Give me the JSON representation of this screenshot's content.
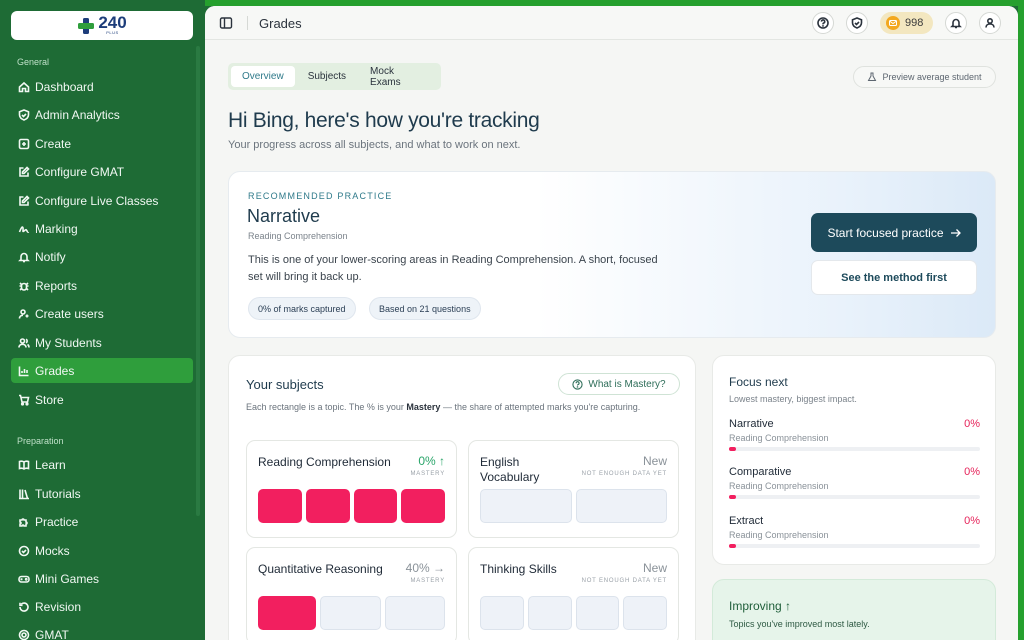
{
  "logo": {
    "number": "240",
    "sub": "PLUS"
  },
  "sidebar": {
    "sections": [
      {
        "label": "General"
      },
      {
        "label": "Preparation"
      }
    ],
    "general_items": [
      {
        "label": "Dashboard",
        "icon": "home-icon"
      },
      {
        "label": "Admin Analytics",
        "icon": "shield-icon"
      },
      {
        "label": "Create",
        "icon": "plus-square-icon"
      },
      {
        "label": "Configure GMAT",
        "icon": "edit-square-icon"
      },
      {
        "label": "Configure Live Classes",
        "icon": "edit-square-icon"
      },
      {
        "label": "Marking",
        "icon": "signature-icon"
      },
      {
        "label": "Notify",
        "icon": "bell-icon"
      },
      {
        "label": "Reports",
        "icon": "bug-icon"
      },
      {
        "label": "Create users",
        "icon": "user-plus-icon"
      },
      {
        "label": "My Students",
        "icon": "users-icon"
      },
      {
        "label": "Grades",
        "icon": "chart-icon",
        "active": true
      },
      {
        "label": "Store",
        "icon": "cart-icon"
      }
    ],
    "prep_items": [
      {
        "label": "Learn",
        "icon": "book-icon"
      },
      {
        "label": "Tutorials",
        "icon": "library-icon"
      },
      {
        "label": "Practice",
        "icon": "puzzle-icon"
      },
      {
        "label": "Mocks",
        "icon": "check-circle-icon"
      },
      {
        "label": "Mini Games",
        "icon": "gamepad-icon"
      },
      {
        "label": "Revision",
        "icon": "refresh-icon"
      },
      {
        "label": "GMAT",
        "icon": "target-icon"
      }
    ]
  },
  "topbar": {
    "title": "Grades",
    "coins": "998"
  },
  "tabs": [
    "Overview",
    "Subjects",
    "Mock Exams"
  ],
  "preview_label": "Preview average student",
  "greeting": "Hi Bing, here's how you're tracking",
  "greeting_sub": "Your progress across all subjects, and what to work on next.",
  "recommended": {
    "eyebrow": "RECOMMENDED PRACTICE",
    "title": "Narrative",
    "subject": "Reading Comprehension",
    "description": "This is one of your lower-scoring areas in Reading Comprehension. A short, focused set will bring it back up.",
    "chip1": "0% of marks captured",
    "chip2": "Based on 21 questions",
    "primary": "Start focused practice",
    "secondary": "See the method first"
  },
  "subjects": {
    "title": "Your subjects",
    "mastery_btn": "What is Mastery?",
    "desc_pre": "Each rectangle is a topic. The % is your ",
    "desc_bold": "Mastery",
    "desc_post": " — the share of attempted marks you're capturing.",
    "tiles": [
      {
        "name": "Reading Comprehension",
        "pct": "0% ↑",
        "tag": "MASTERY",
        "pct_color": "#2aa56a",
        "blocks": [
          "red",
          "red",
          "red",
          "red"
        ]
      },
      {
        "name": "English Vocabulary",
        "pct": "New",
        "tag": "NOT ENOUGH DATA YET",
        "pct_color": "#8a9299",
        "blocks": [
          "empty",
          "empty"
        ]
      },
      {
        "name": "Quantitative Reasoning",
        "pct": "40% →",
        "tag": "MASTERY",
        "pct_color": "#8a9299",
        "blocks": [
          "red",
          "empty",
          "empty"
        ]
      },
      {
        "name": "Thinking Skills",
        "pct": "New",
        "tag": "NOT ENOUGH DATA YET",
        "pct_color": "#8a9299",
        "blocks": [
          "empty",
          "empty",
          "empty",
          "empty"
        ]
      }
    ]
  },
  "focus": {
    "title": "Focus next",
    "sub": "Lowest mastery, biggest impact.",
    "items": [
      {
        "name": "Narrative",
        "category": "Reading Comprehension",
        "pct": "0%"
      },
      {
        "name": "Comparative",
        "category": "Reading Comprehension",
        "pct": "0%"
      },
      {
        "name": "Extract",
        "category": "Reading Comprehension",
        "pct": "0%"
      }
    ]
  },
  "improving": {
    "title": "Improving ↑",
    "sub": "Topics you've improved most lately."
  }
}
